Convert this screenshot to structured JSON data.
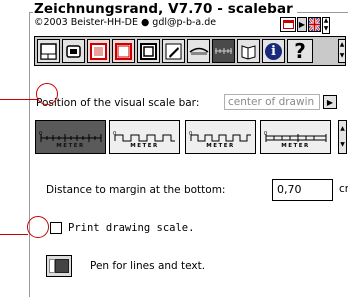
{
  "window": {
    "title": "Zeichnungsrand, V7.70 - scalebar",
    "copyright": "©2003 Beister-HH-DE ● gdl@p-b-a.de"
  },
  "top_icons": [
    "calendar-icon",
    "arrow-right-icon",
    "uk-flag-icon",
    "scroll-arrows-icon"
  ],
  "toolbar": {
    "buttons": [
      "frame-icon",
      "stamp-icon",
      "red-frame-icon",
      "red-frame-icon",
      "frame-thick-icon",
      "edit-icon",
      "pen-icon",
      "scalebar-icon",
      "book-icon",
      "info-icon",
      "help-icon"
    ],
    "info_label": "i",
    "help_label": "?"
  },
  "position": {
    "label": "Position of the visual scale bar:",
    "value": "center of drawin"
  },
  "scalebars": {
    "styles": [
      "style-1",
      "style-2",
      "style-3",
      "style-4"
    ],
    "selected_index": 0,
    "meter_label": "METER",
    "zero_label": "0"
  },
  "distance": {
    "label": "Distance to margin at the bottom:",
    "value": "0,70",
    "unit": "cm"
  },
  "print_scale": {
    "label": "Print drawing scale.",
    "checked": false
  },
  "pen": {
    "label": "Pen for lines and text."
  },
  "colors": {
    "callout": "#cc0000",
    "selected_scalebar": "#5a5a5a"
  }
}
